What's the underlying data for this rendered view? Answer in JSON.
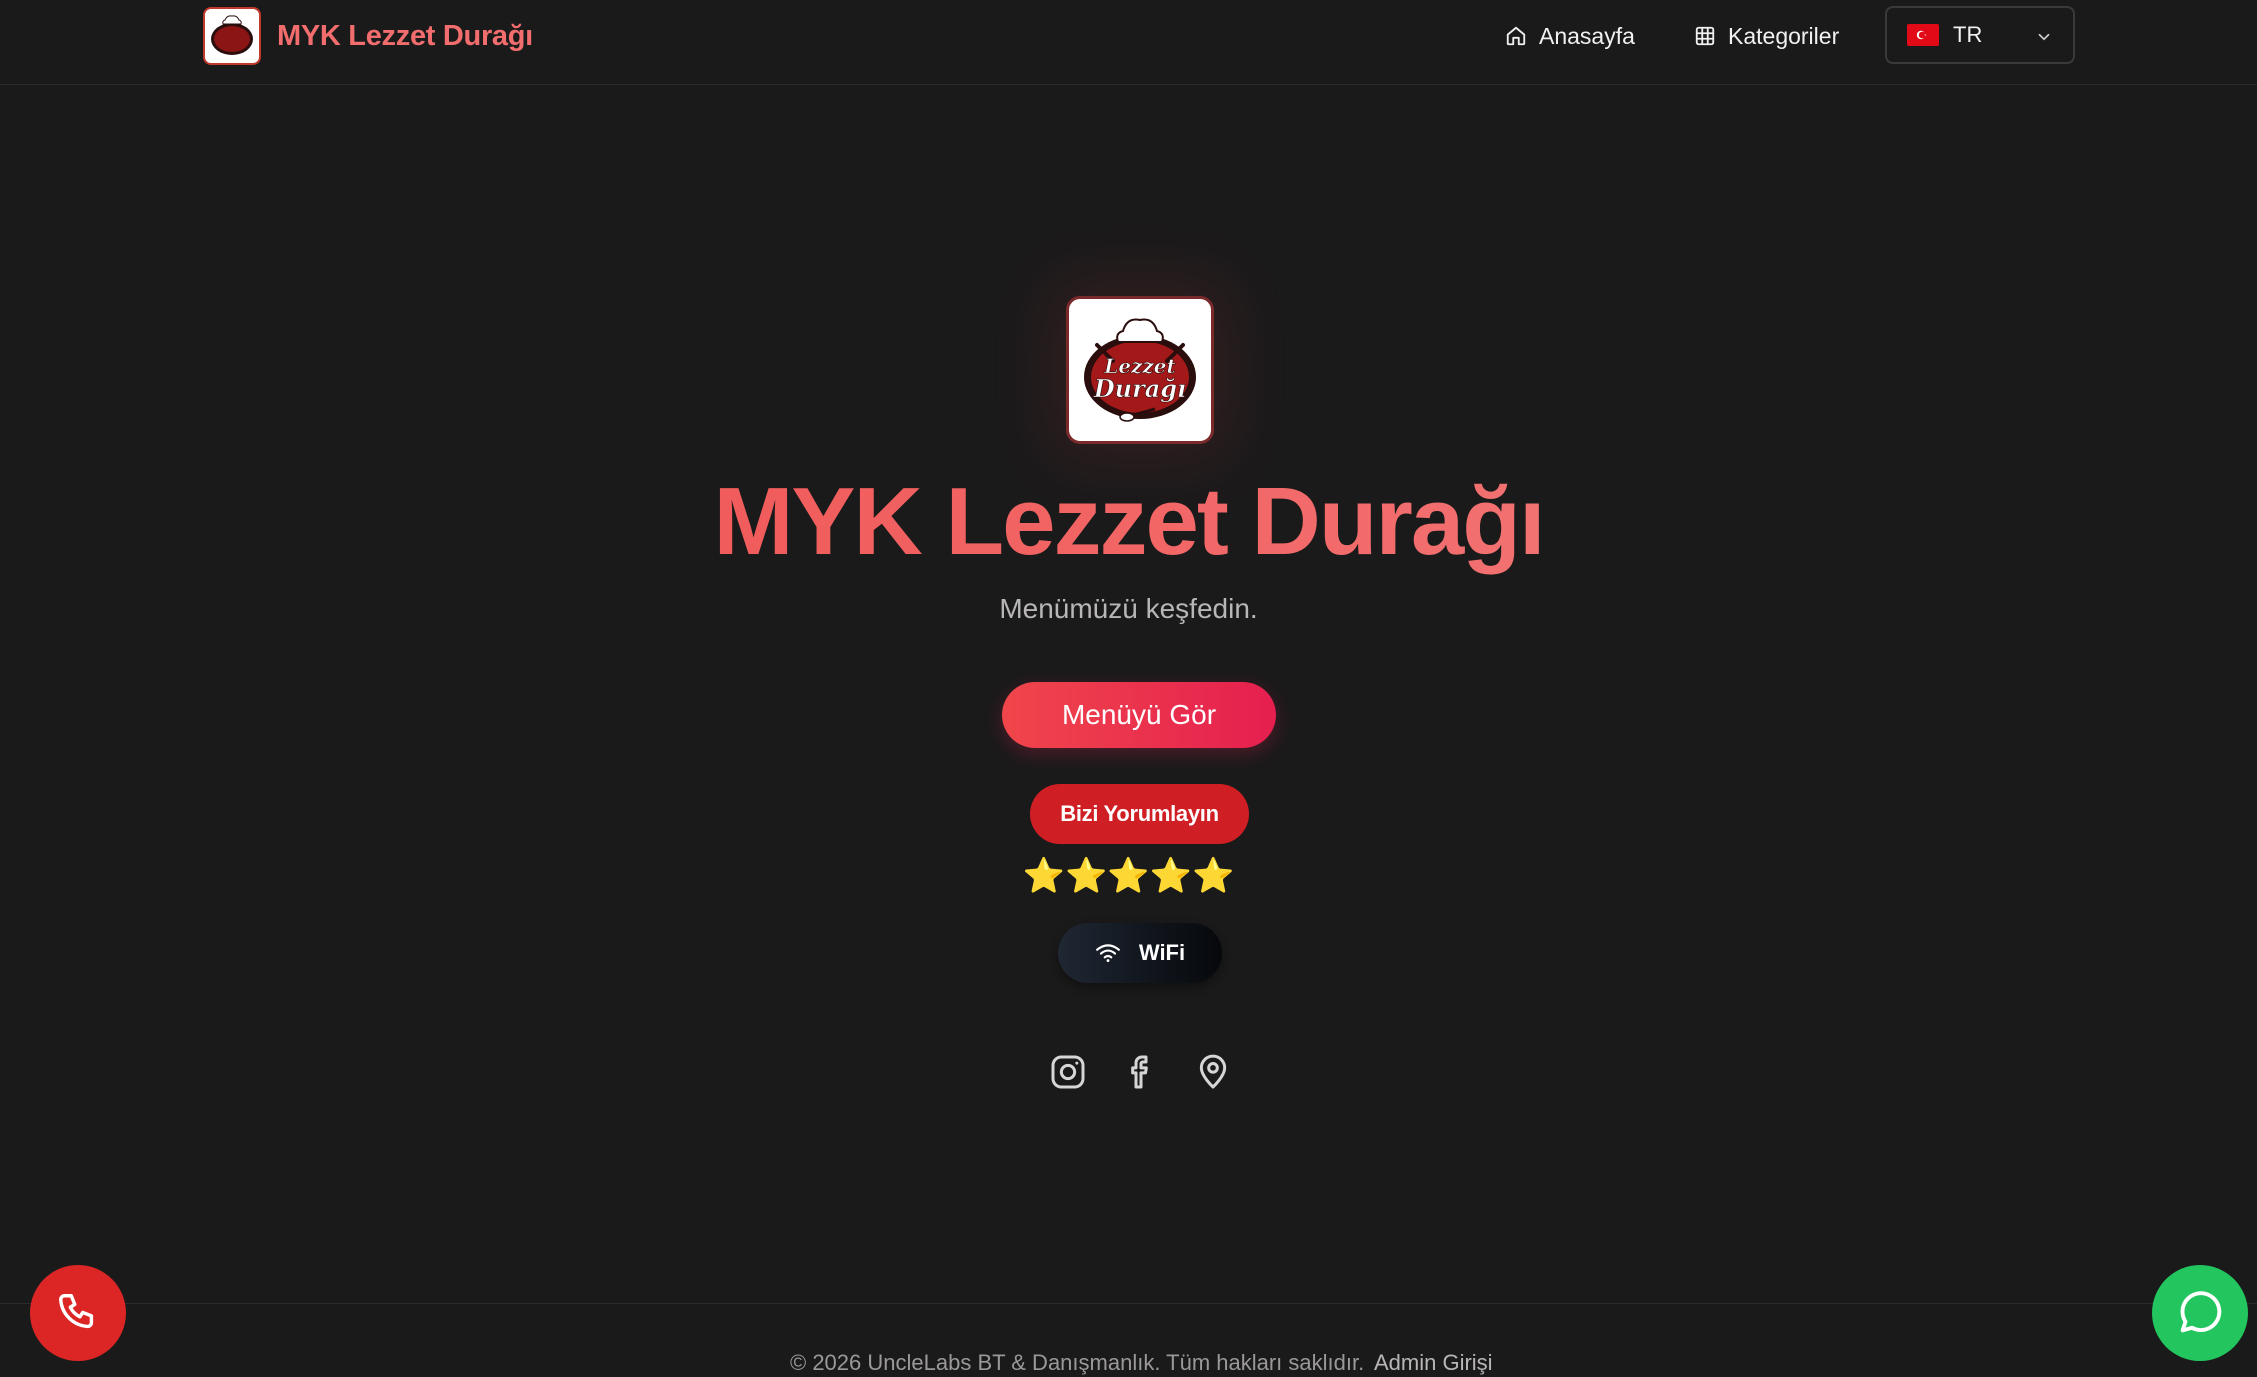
{
  "header": {
    "brand_name": "MYK Lezzet Durağı",
    "logo_text_top": "Lezzet",
    "logo_text_bottom": "Durağı",
    "nav": [
      {
        "label": "Anasayfa",
        "icon": "home-icon"
      },
      {
        "label": "Kategoriler",
        "icon": "grid-icon"
      }
    ],
    "language": {
      "selected": "TR",
      "flag": "turkey-flag-icon"
    }
  },
  "hero": {
    "title": "MYK Lezzet Durağı",
    "subtitle": "Menümüzü keşfedin.",
    "menu_button": "Menüyü Gör",
    "review_button": "Bizi Yorumlayın",
    "stars": "⭐⭐⭐⭐⭐",
    "rating_stars": 5,
    "wifi_button": "WiFi",
    "social": [
      "instagram-icon",
      "facebook-icon",
      "map-pin-icon"
    ]
  },
  "footer": {
    "copyright": "© 2026 UncleLabs BT & Danışmanlık. Tüm hakları saklıdır.",
    "admin_link": "Admin Girişi"
  },
  "floating": {
    "phone": "phone-icon",
    "whatsapp": "whatsapp-icon"
  },
  "colors": {
    "background": "#1b1a1b",
    "accent": "#f26d6d",
    "primary_button": "#e51f4f",
    "review_button": "#d01f24",
    "star": "#f9c21b",
    "whatsapp": "#22c55e",
    "phone": "#dc2626"
  }
}
